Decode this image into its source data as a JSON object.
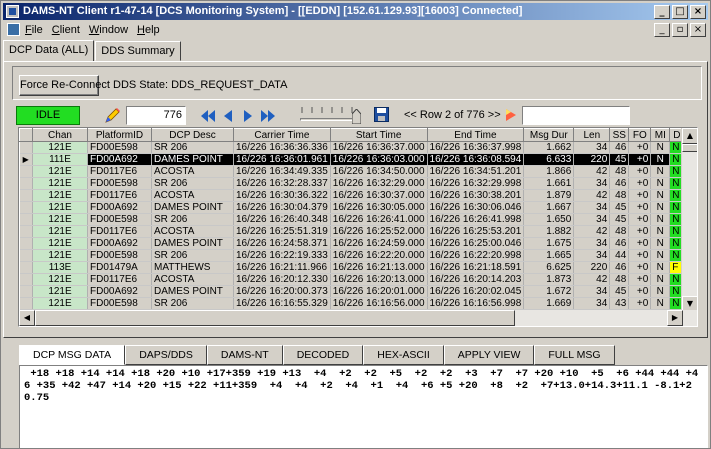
{
  "window": {
    "title": "DAMS-NT Client r1-47-14 [DCS Monitoring System] - [[EDDN] [152.61.129.93][16003] Connected]",
    "minimize": "_",
    "maximize": "□",
    "close": "×"
  },
  "menu": {
    "items": [
      "File",
      "Client",
      "Window",
      "Help"
    ],
    "mdi_minimize": "_",
    "mdi_restore": "▫",
    "mdi_close": "×"
  },
  "tabs": [
    "DCP Data (ALL)",
    "DDS Summary"
  ],
  "force_button": "Force Re-Connect",
  "dds_state": "DDS State: DDS_REQUEST_DATA",
  "toolbar": {
    "status": "IDLE",
    "record_value": "776",
    "row_info": "<< Row 2 of 776 >>",
    "search_value": ""
  },
  "colors": {
    "idle_green": "#22dd22",
    "dq_n": "#22dd22",
    "dq_f": "#ffff00",
    "title_blue": "#0a246a"
  },
  "grid": {
    "columns": [
      "Chan",
      "PlatformID",
      "DCP Desc",
      "Carrier Time",
      "Start Time",
      "End Time",
      "Msg Dur",
      "Len",
      "SS",
      "FO",
      "MI",
      "DQ"
    ],
    "current_row_marker": "▶",
    "rows": [
      [
        "121E",
        "FD00E598",
        "SR 206",
        "16/226 16:36:36.336",
        "16/226 16:36:37.000",
        "16/226 16:36:37.998",
        "1.662",
        "34",
        "46",
        "+0",
        "N",
        "N"
      ],
      [
        "111E",
        "FD00A692",
        "DAMES POINT",
        "16/226 16:36:01.961",
        "16/226 16:36:03.000",
        "16/226 16:36:08.594",
        "6.633",
        "220",
        "45",
        "+0",
        "N",
        "N"
      ],
      [
        "121E",
        "FD0117E6",
        "ACOSTA",
        "16/226 16:34:49.335",
        "16/226 16:34:50.000",
        "16/226 16:34:51.201",
        "1.866",
        "42",
        "48",
        "+0",
        "N",
        "N"
      ],
      [
        "121E",
        "FD00E598",
        "SR 206",
        "16/226 16:32:28.337",
        "16/226 16:32:29.000",
        "16/226 16:32:29.998",
        "1.661",
        "34",
        "46",
        "+0",
        "N",
        "N"
      ],
      [
        "121E",
        "FD0117E6",
        "ACOSTA",
        "16/226 16:30:36.322",
        "16/226 16:30:37.000",
        "16/226 16:30:38.201",
        "1.879",
        "42",
        "48",
        "+0",
        "N",
        "N"
      ],
      [
        "121E",
        "FD00A692",
        "DAMES POINT",
        "16/226 16:30:04.379",
        "16/226 16:30:05.000",
        "16/226 16:30:06.046",
        "1.667",
        "34",
        "45",
        "+0",
        "N",
        "N"
      ],
      [
        "121E",
        "FD00E598",
        "SR 206",
        "16/226 16:26:40.348",
        "16/226 16:26:41.000",
        "16/226 16:26:41.998",
        "1.650",
        "34",
        "45",
        "+0",
        "N",
        "N"
      ],
      [
        "121E",
        "FD0117E6",
        "ACOSTA",
        "16/226 16:25:51.319",
        "16/226 16:25:52.000",
        "16/226 16:25:53.201",
        "1.882",
        "42",
        "48",
        "+0",
        "N",
        "N"
      ],
      [
        "121E",
        "FD00A692",
        "DAMES POINT",
        "16/226 16:24:58.371",
        "16/226 16:24:59.000",
        "16/226 16:25:00.046",
        "1.675",
        "34",
        "46",
        "+0",
        "N",
        "N"
      ],
      [
        "121E",
        "FD00E598",
        "SR 206",
        "16/226 16:22:19.333",
        "16/226 16:22:20.000",
        "16/226 16:22:20.998",
        "1.665",
        "34",
        "44",
        "+0",
        "N",
        "N"
      ],
      [
        "113E",
        "FD01479A",
        "MATTHEWS",
        "16/226 16:21:11.966",
        "16/226 16:21:13.000",
        "16/226 16:21:18.591",
        "6.625",
        "220",
        "46",
        "+0",
        "N",
        "F"
      ],
      [
        "121E",
        "FD0117E6",
        "ACOSTA",
        "16/226 16:20:12.330",
        "16/226 16:20:13.000",
        "16/226 16:20:14.203",
        "1.873",
        "42",
        "48",
        "+0",
        "N",
        "N"
      ],
      [
        "121E",
        "FD00A692",
        "DAMES POINT",
        "16/226 16:20:00.373",
        "16/226 16:20:01.000",
        "16/226 16:20:02.045",
        "1.672",
        "34",
        "45",
        "+0",
        "N",
        "N"
      ],
      [
        "121E",
        "FD00E598",
        "SR 206",
        "16/226 16:16:55.329",
        "16/226 16:16:56.000",
        "16/226 16:16:56.998",
        "1.669",
        "34",
        "43",
        "+0",
        "N",
        "N"
      ]
    ],
    "selected_index": 1
  },
  "bottom_tabs": [
    "DCP MSG DATA",
    "DAPS/DDS",
    "DAMS-NT",
    "DECODED",
    "HEX-ASCII",
    "APPLY VIEW",
    "FULL MSG"
  ],
  "message": " +18 +18 +14 +14 +18 +20 +10 +17+359 +19 +13  +4  +2  +2  +5  +2  +2  +3  +7  +7 +20 +10  +5  +6 +44 +44 +46 +35 +42 +47 +14 +20 +15 +22 +11+359  +4  +4  +2  +4  +1  +4  +6 +5 +20  +8  +2  +7+13.0+14.3+11.1 -8.1+20.75"
}
